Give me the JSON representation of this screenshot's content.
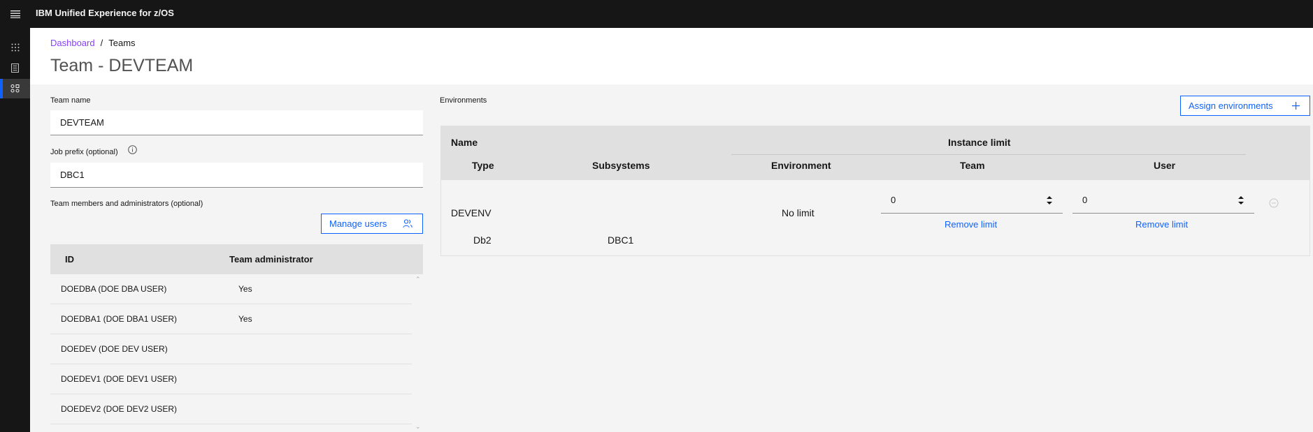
{
  "header": {
    "app_title": "IBM Unified Experience for z/OS"
  },
  "breadcrumb": {
    "dashboard": "Dashboard",
    "separator": "/",
    "current": "Teams"
  },
  "page": {
    "title": "Team - DEVTEAM"
  },
  "form": {
    "team_name_label": "Team name",
    "team_name_value": "DEVTEAM",
    "job_prefix_label": "Job prefix (optional)",
    "job_prefix_value": "DBC1",
    "members_label": "Team members and administrators (optional)",
    "manage_users_label": "Manage users"
  },
  "members_table": {
    "columns": [
      "ID",
      "Team administrator"
    ],
    "rows": [
      {
        "id": "DOEDBA (DOE DBA USER)",
        "admin": "Yes"
      },
      {
        "id": "DOEDBA1 (DOE DBA1 USER)",
        "admin": "Yes"
      },
      {
        "id": "DOEDEV (DOE DEV USER)",
        "admin": ""
      },
      {
        "id": "DOEDEV1 (DOE DEV1 USER)",
        "admin": ""
      },
      {
        "id": "DOEDEV2 (DOE DEV2 USER)",
        "admin": ""
      }
    ]
  },
  "environments": {
    "label": "Environments",
    "assign_label": "Assign environments",
    "headers": {
      "name": "Name",
      "instance_limit": "Instance limit",
      "type": "Type",
      "subsystems": "Subsystems",
      "environment": "Environment",
      "team": "Team",
      "user": "User"
    },
    "row": {
      "name": "DEVENV",
      "type": "Db2",
      "subsystems": "DBC1",
      "environment_limit": "No limit",
      "team_limit": "0",
      "user_limit": "0",
      "remove_limit_label": "Remove limit"
    }
  },
  "colors": {
    "accent": "#0f62fe",
    "link_visited": "#8a3ffc",
    "topbar": "#161616"
  }
}
